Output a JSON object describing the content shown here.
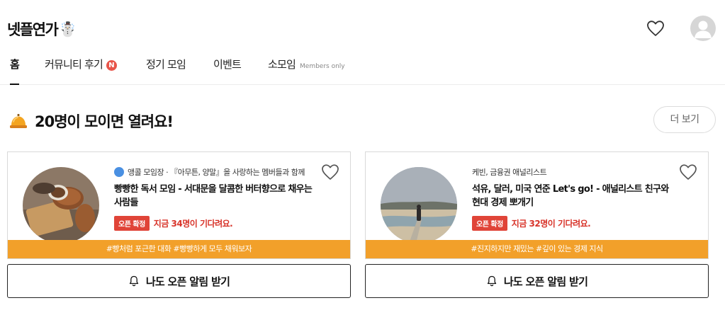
{
  "header": {
    "logo_text": "넷플연가",
    "logo_emoji": "☃️"
  },
  "tabs": [
    {
      "label": "홈",
      "active": true
    },
    {
      "label": "커뮤니티 후기",
      "badge": "N"
    },
    {
      "label": "정기 모임"
    },
    {
      "label": "이벤트"
    },
    {
      "label": "소모임",
      "note": "Members only"
    }
  ],
  "section": {
    "title": "20명이 모이면 열려요!",
    "more_label": "더 보기"
  },
  "cards": [
    {
      "host": "앵콜 모임장 · 『아무튼, 양말』을 사랑하는 멤버들과 함께",
      "title": "빵빵한 독서 모임 - 서대문을 달콤한 버터향으로 채우는 사람들",
      "open_badge": "오픈 확정",
      "waiting": "지금 34명이 기다려요.",
      "tags": "#빵처럼 포근한 대화 #빵빵하게 모두 채워보자",
      "notify_label": "나도 오픈 알림 받기"
    },
    {
      "host": "케빈, 금융권 애널리스트",
      "title": "석유, 달러, 미국 연준 Let's go! - 애널리스트 친구와 현대 경제 뽀개기",
      "open_badge": "오픈 확정",
      "waiting": "지금 32명이 기다려요.",
      "tags": "#진지하지만 재밌는 #깊이 있는 경제 지식",
      "notify_label": "나도 오픈 알림 받기"
    }
  ],
  "colors": {
    "accent_orange": "#f2a02a",
    "badge_red": "#e04438",
    "text_red": "#d8342a",
    "n_badge": "#e8554a"
  },
  "icons": {
    "favorite": "heart-outline-icon",
    "profile": "user-avatar-icon",
    "section": "service-bell-icon",
    "notify": "bell-icon",
    "host": "people-icon"
  }
}
